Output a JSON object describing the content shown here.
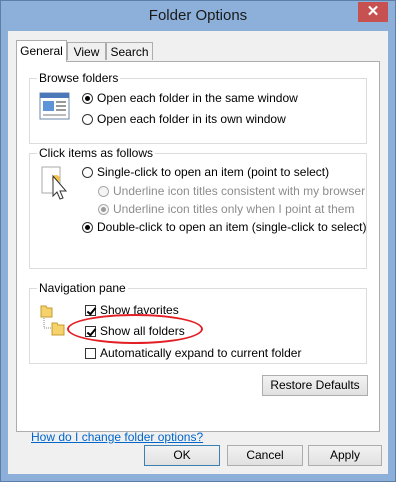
{
  "window": {
    "title": "Folder Options",
    "close_glyph": "✕"
  },
  "tabs": [
    "General",
    "View",
    "Search"
  ],
  "browse_folders": {
    "label": "Browse folders",
    "options": [
      {
        "label": "Open each folder in the same window",
        "selected": true
      },
      {
        "label": "Open each folder in its own window",
        "selected": false
      }
    ]
  },
  "click_items": {
    "label": "Click items as follows",
    "single_click": "Single-click to open an item (point to select)",
    "underline_browser": "Underline icon titles consistent with my browser",
    "underline_point": "Underline icon titles only when I point at them",
    "double_click": "Double-click to open an item (single-click to select)"
  },
  "navigation_pane": {
    "label": "Navigation pane",
    "show_favorites": {
      "label": "Show favorites",
      "checked": true
    },
    "show_all_folders": {
      "label": "Show all folders",
      "checked": true
    },
    "auto_expand": {
      "label": "Automatically expand to current folder",
      "checked": false
    }
  },
  "restore_defaults": "Restore Defaults",
  "help_link": "How do I change folder options?",
  "buttons": {
    "ok": "OK",
    "cancel": "Cancel",
    "apply": "Apply"
  },
  "icons": [
    "window-icon",
    "cursor-click-icon",
    "folder-tree-icon",
    "close-icon"
  ],
  "colors": {
    "titlebar": "#8cb0d9",
    "close": "#c75050",
    "highlight_ellipse": "#e31f26",
    "link": "#0066cc"
  }
}
